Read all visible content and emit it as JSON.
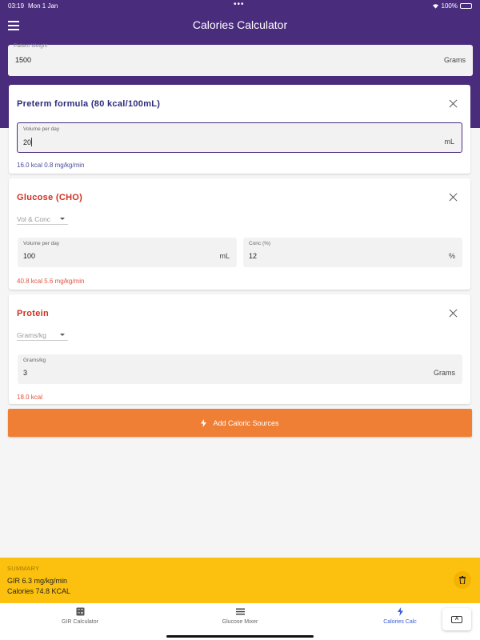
{
  "status_bar": {
    "time": "03:19",
    "date": "Mon 1 Jan",
    "battery": "100%"
  },
  "app": {
    "title": "Calories Calculator"
  },
  "weight": {
    "label": "Patient Weight",
    "value": "1500",
    "unit": "Grams"
  },
  "formula_card": {
    "title": "Preterm formula (80 kcal/100mL)",
    "title_color": "#2c2c7a",
    "field_label": "Volume per day",
    "field_value": "20",
    "field_unit": "mL",
    "result": "16.0 kcal   0.8 mg/kg/min",
    "result_color": "#4a4a9a"
  },
  "glucose_card": {
    "title": "Glucose (CHO)",
    "title_color": "#d0301f",
    "dropdown": "Vol & Conc",
    "field1_label": "Volume per day",
    "field1_value": "100",
    "field1_unit": "mL",
    "field2_label": "Conc (%)",
    "field2_value": "12",
    "field2_unit": "%",
    "result": "40.8 kcal   5.6 mg/kg/min",
    "result_color": "#e0533e"
  },
  "protein_card": {
    "title": "Protein",
    "title_color": "#d0301f",
    "dropdown": "Grams/kg",
    "field_label": "Grams/kg",
    "field_value": "3",
    "field_unit": "Grams",
    "result": "18.0 kcal",
    "result_color": "#e0533e"
  },
  "add_button": {
    "label": "Add Caloric Sources",
    "icon": "bolt-icon",
    "color": "#ee7f35"
  },
  "summary": {
    "title": "SUMMARY",
    "gir": "GIR 6.3 mg/kg/min",
    "calories": "Calories 74.8 KCAL",
    "color": "#fcc10e"
  },
  "nav": {
    "items": [
      {
        "label": "GIR Calculator",
        "icon": "calculator-icon"
      },
      {
        "label": "Glucose Mixer",
        "icon": "list-icon"
      },
      {
        "label": "Calories Calc",
        "icon": "bolt-icon"
      }
    ],
    "active_index": 2
  },
  "colors": {
    "brand": "#4a2c7d",
    "accent": "#ee7f35",
    "summary": "#fcc10e",
    "active_nav": "#3a5bd9"
  }
}
